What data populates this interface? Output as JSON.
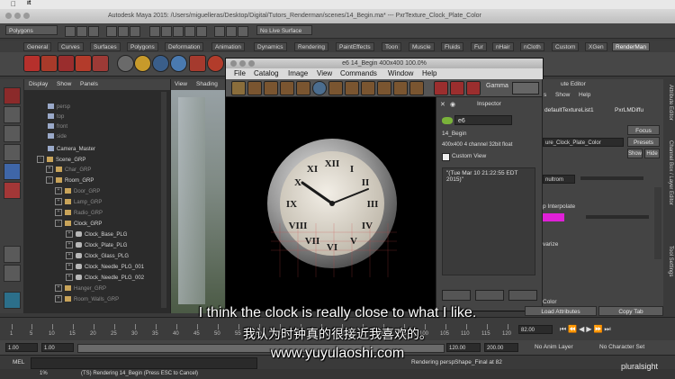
{
  "mac_menu": {
    "app_name": "it"
  },
  "title_bar": {
    "title": "Autodesk Maya 2015: /Users/miguelleras/Desktop/Digital/Tutors_Renderman/scenes/14_Begin.ma* --- PxrTexture_Clock_Plate_Color"
  },
  "status_line": {
    "menu_set": "Polygons",
    "live_surface": "No Live Surface"
  },
  "shelf_tabs": [
    "General",
    "Curves",
    "Surfaces",
    "Polygons",
    "Deformation",
    "Animation",
    "Dynamics",
    "Rendering",
    "PaintEffects",
    "Toon",
    "Muscle",
    "Fluids",
    "Fur",
    "nHair",
    "nCloth",
    "Custom",
    "XGen",
    "RenderMan"
  ],
  "shelf_active": "RenderMan",
  "outliner": {
    "menu": [
      "Display",
      "Show",
      "Panels"
    ],
    "items": [
      {
        "label": "persp",
        "dim": true
      },
      {
        "label": "top",
        "dim": true
      },
      {
        "label": "front",
        "dim": true
      },
      {
        "label": "side",
        "dim": true
      },
      {
        "label": "Camera_Master",
        "dim": false
      },
      {
        "label": "Scene_GRP",
        "dim": false
      },
      {
        "label": "Char_GRP",
        "dim": true
      },
      {
        "label": "Room_GRP",
        "dim": false
      },
      {
        "label": "Door_GRP",
        "dim": true
      },
      {
        "label": "Lamp_GRP",
        "dim": true
      },
      {
        "label": "Radio_GRP",
        "dim": true
      },
      {
        "label": "Clock_GRP",
        "dim": false
      },
      {
        "label": "Clock_Base_PLG",
        "dim": false
      },
      {
        "label": "Clock_Plate_PLG",
        "dim": false
      },
      {
        "label": "Clock_Glass_PLG",
        "dim": false
      },
      {
        "label": "Clock_Needle_PLG_001",
        "dim": false
      },
      {
        "label": "Clock_Needle_PLG_002",
        "dim": false
      },
      {
        "label": "Hanger_GRP",
        "dim": true
      },
      {
        "label": "Room_Walls_GRP",
        "dim": true
      }
    ]
  },
  "viewport": {
    "menu": [
      "View",
      "Shading"
    ]
  },
  "render_view": {
    "title": "e6 14_Begin 400x400 100.0%",
    "menu": [
      "File",
      "Catalog",
      "Image",
      "View",
      "Commands",
      "Window",
      "Help"
    ],
    "gamma_label": "Gamma",
    "inspector": {
      "heading": "Inspector",
      "image_name": "e6",
      "scene": "14_Begin",
      "info": "400x400 4 channel 32bit float",
      "custom_view": "Custom View",
      "timestamp": "\"(Tue Mar 10 21:22:55 EDT 2015)\""
    }
  },
  "attribute_editor": {
    "title": "ute Editor",
    "menu": [
      "s",
      "Show",
      "Help"
    ],
    "node_tab": "defaultTextureList1",
    "node_tab2": "PxrLMDiffu",
    "focus": "Focus",
    "presets": "Presets",
    "show": "Show",
    "hide": "Hide",
    "node_name": "ure_Clock_Plate_Color",
    "filter_value": "nultrom",
    "interpolate_label": "p Interpolate",
    "warize_label": "varize",
    "color_label": "Color",
    "load_attributes": "Load Attributes",
    "copy_tab": "Copy Tab",
    "accent_magenta": "#e020d8"
  },
  "side_tabs": [
    "Attribute Editor",
    "Channel Box / Layer Editor",
    "Tool Settings"
  ],
  "timeline": {
    "ticks": [
      "1",
      "5",
      "10",
      "15",
      "20",
      "25",
      "30",
      "35",
      "40",
      "45",
      "50",
      "55",
      "60",
      "65",
      "70",
      "75",
      "80",
      "85",
      "90",
      "95",
      "100",
      "105",
      "110",
      "115",
      "120"
    ],
    "current_frame": "82.00"
  },
  "range": {
    "start": "1.00",
    "start2": "1.00",
    "end": "120.00",
    "end2": "200.00",
    "anim_layer": "No Anim Layer",
    "character_set": "No Character Set"
  },
  "command_line": {
    "label": "MEL"
  },
  "help_line": {
    "progress": "1%",
    "left_msg": "(TS) Rendering 14_Begin (Press ESC to Cancel)",
    "right_msg": "Rendering perspShape_Final at 82"
  },
  "subtitles": {
    "english": "I think the clock is really close to what I like.",
    "chinese": "我认为时钟真的很接近我喜欢的。",
    "watermark": "www.yuyulaoshi.com"
  },
  "brand": "pluralsight"
}
